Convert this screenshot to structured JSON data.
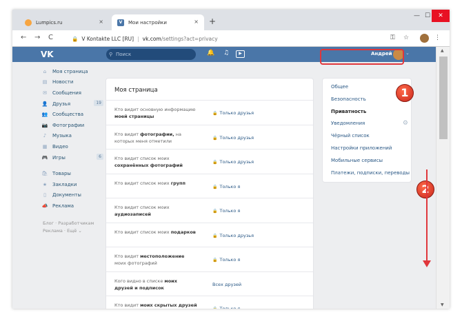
{
  "browser": {
    "tabs": [
      {
        "title": "Lumpics.ru",
        "close": "×"
      },
      {
        "title": "Мои настройки",
        "close": "×"
      }
    ],
    "new_tab": "+",
    "window_controls": {
      "minimize": "—",
      "maximize": "☐",
      "close": "✕"
    },
    "address": {
      "site_name": "V Kontakte LLC [RU]",
      "separator": "|",
      "host": "vk.com",
      "path": "/settings?act=privacy"
    }
  },
  "vk_header": {
    "logo": "VK",
    "search_placeholder": "Поиск",
    "user_name": "Андрей"
  },
  "left_nav": [
    {
      "icon": "⌂",
      "label": "Моя страница",
      "badge": ""
    },
    {
      "icon": "▤",
      "label": "Новости",
      "badge": ""
    },
    {
      "icon": "✉",
      "label": "Сообщения",
      "badge": ""
    },
    {
      "icon": "👤",
      "label": "Друзья",
      "badge": "19"
    },
    {
      "icon": "👥",
      "label": "Сообщества",
      "badge": ""
    },
    {
      "icon": "📷",
      "label": "Фотографии",
      "badge": ""
    },
    {
      "icon": "♪",
      "label": "Музыка",
      "badge": ""
    },
    {
      "icon": "▦",
      "label": "Видео",
      "badge": ""
    },
    {
      "icon": "🎮",
      "label": "Игры",
      "badge": "6"
    }
  ],
  "left_nav_2": [
    {
      "icon": "🛍",
      "label": "Товары"
    },
    {
      "icon": "★",
      "label": "Закладки"
    },
    {
      "icon": "▯",
      "label": "Документы"
    },
    {
      "icon": "📣",
      "label": "Реклама"
    }
  ],
  "left_footer": {
    "line1": "Блог · Разработчикам",
    "line2": "Реклама · Ещё ⌄"
  },
  "settings": {
    "title": "Моя страница",
    "rows": [
      {
        "pre": "Кто видит основную информацию ",
        "bold": "моей страницы",
        "post": "",
        "value": "Только друзья",
        "lock": true
      },
      {
        "pre": "Кто видит ",
        "bold": "фотографии,",
        "post": " на которых меня отметили",
        "value": "Только друзья",
        "lock": true
      },
      {
        "pre": "Кто видит список моих ",
        "bold": "сохранённых фотографий",
        "post": "",
        "value": "Только друзья",
        "lock": true
      },
      {
        "pre": "Кто видит список моих ",
        "bold": "групп",
        "post": "",
        "value": "Только я",
        "lock": true
      },
      {
        "pre": "Кто видит список моих ",
        "bold": "аудиозаписей",
        "post": "",
        "value": "Только я",
        "lock": true
      },
      {
        "pre": "Кто видит список моих ",
        "bold": "подарков",
        "post": "",
        "value": "Только друзья",
        "lock": true
      },
      {
        "pre": "Кто видит ",
        "bold": "местоположение",
        "post": " моих фотографий",
        "value": "Только я",
        "lock": true
      },
      {
        "pre": "Кого видно в списке ",
        "bold": "моих друзей и подписок",
        "post": "",
        "value": "Всех друзей",
        "lock": false
      },
      {
        "pre": "Кто видит ",
        "bold": "моих скрытых друзей",
        "post": "",
        "value": "Только я",
        "lock": true
      }
    ]
  },
  "right_menu": [
    {
      "label": "Общее",
      "active": false
    },
    {
      "label": "Безопасность",
      "active": false
    },
    {
      "label": "Приватность",
      "active": true
    },
    {
      "label": "Уведомления",
      "active": false
    },
    {
      "label": "Чёрный список",
      "active": false
    },
    {
      "label": "Настройки приложений",
      "active": false
    },
    {
      "label": "Мобильные сервисы",
      "active": false
    },
    {
      "label": "Платежи, подписки, переводы",
      "active": false
    }
  ],
  "callouts": {
    "one": "1",
    "two": "2"
  },
  "colors": {
    "vk_blue": "#4a76a8",
    "accent_red": "#e0363b",
    "link": "#2a5885"
  }
}
